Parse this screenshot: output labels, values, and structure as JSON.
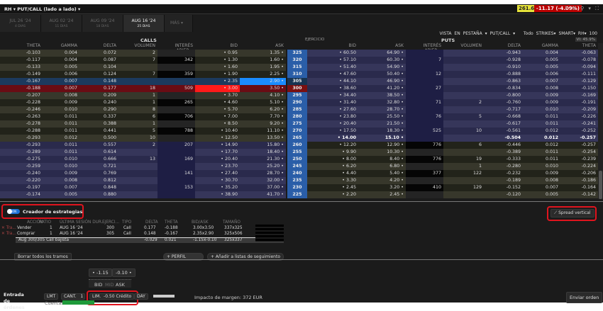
{
  "window": {
    "title": "RH ▾ PUT/CALL (lado a lado) ▾",
    "price": "261.67",
    "change": "-11.17 (-4.09%)",
    "icons": [
      "help-icon",
      "gear-icon",
      "link-icon",
      "menu-icon",
      "expand-icon"
    ],
    "icon_glyphs": "? ⚙ ⚲ ▾ ⛶"
  },
  "tabs": [
    {
      "label": "JUL 26 '24",
      "days": "4 DIAS"
    },
    {
      "label": "AUG 02 '24",
      "days": "11 DIAS"
    },
    {
      "label": "AUG 09 '24",
      "days": "18 DIAS"
    },
    {
      "label": "AUG 16 '24",
      "days": "25 DIAS",
      "active": true
    }
  ],
  "tab_more": "MÁS ▾",
  "view": {
    "tab_view": "VISTA EN PESTAÑA ▾",
    "putcall": "PUT/CALL ▾",
    "strikes": "Todo STRIKES▾",
    "exchange": "SMART▾",
    "symbol": "RH▾",
    "qty": "100"
  },
  "sections": {
    "calls": "CALLS",
    "puts": "PUTS",
    "strike": "EJERCICIO",
    "iv": "VI: 45.9%"
  },
  "columns": {
    "calls": [
      "THETA",
      "GAMMA",
      "DELTA",
      "VOLUMEN",
      "INTERÉS ABIER...",
      "BID",
      "ASK"
    ],
    "puts": [
      "BID",
      "ASK",
      "INTERÉS ABIER...",
      "VOLUMEN",
      "DELTA",
      "GAMMA",
      "THETA"
    ]
  },
  "colors": {
    "strike": "#2a5ea8",
    "bid_highlight": "#ff1a1a",
    "ask_highlight": "#1a8cff",
    "selected_sell_row": "#6a0c14",
    "selected_buy_row": "#1c3a5e",
    "accent_red": "#e0141e"
  },
  "rows": [
    [
      "-0.103",
      "0.004",
      "0.072",
      "2",
      "",
      "• 0.95",
      "1.35 •",
      "325",
      "• 60.50",
      "64.90 •",
      "",
      "",
      "-0.943",
      "0.004",
      "-0.063"
    ],
    [
      "-0.117",
      "0.004",
      "0.087",
      "7",
      "342",
      "• 1.30",
      "1.60 •",
      "320",
      "• 57.10",
      "60.30 •",
      "7",
      "",
      "-0.928",
      "0.005",
      "-0.078"
    ],
    [
      "-0.133",
      "0.005",
      "0.104",
      "",
      "",
      "• 1.60",
      "1.95 •",
      "315",
      "• 51.40",
      "54.90 •",
      "",
      "",
      "-0.910",
      "0.005",
      "-0.094"
    ],
    [
      "-0.149",
      "0.006",
      "0.124",
      "7",
      "359",
      "• 1.90",
      "2.25 •",
      "310",
      "• 47.60",
      "50.40 •",
      "12",
      "",
      "-0.888",
      "0.006",
      "-0.111"
    ],
    [
      "-0.167",
      "0.007",
      "0.148",
      "",
      "",
      "• 2.35",
      "2.90 •",
      "305",
      "• 44.10",
      "46.90 •",
      "",
      "",
      "-0.863",
      "0.007",
      "-0.129"
    ],
    [
      "-0.188",
      "0.007",
      "0.177",
      "18",
      "509",
      "• 3.00",
      "3.50 •",
      "300",
      "• 38.60",
      "41.20 •",
      "27",
      "",
      "-0.834",
      "0.008",
      "-0.150"
    ],
    [
      "-0.207",
      "0.008",
      "0.209",
      "1",
      "",
      "• 3.70",
      "4.10 •",
      "295",
      "• 34.40",
      "38.50 •",
      "",
      "",
      "-0.800",
      "0.009",
      "-0.169"
    ],
    [
      "-0.228",
      "0.009",
      "0.240",
      "1",
      "265",
      "• 4.60",
      "5.10 •",
      "290",
      "• 31.40",
      "32.80 •",
      "71",
      "2",
      "-0.760",
      "0.009",
      "-0.191"
    ],
    [
      "-0.246",
      "0.010",
      "0.290",
      "8",
      "",
      "• 5.70",
      "6.20 •",
      "285",
      "• 27.60",
      "28.70 •",
      "",
      "",
      "-0.717",
      "0.010",
      "-0.209"
    ],
    [
      "-0.263",
      "0.011",
      "0.337",
      "6",
      "706",
      "• 7.00",
      "7.70 •",
      "280",
      "• 23.80",
      "25.50 •",
      "76",
      "5",
      "-0.668",
      "0.011",
      "-0.226"
    ],
    [
      "-0.278",
      "0.011",
      "0.388",
      "1",
      "",
      "• 8.50",
      "9.20 •",
      "275",
      "• 20.40",
      "21.50 •",
      "",
      "",
      "-0.617",
      "0.011",
      "-0.241"
    ],
    [
      "-0.288",
      "0.011",
      "0.441",
      "5",
      "788",
      "• 10.40",
      "11.10 •",
      "270",
      "• 17.50",
      "18.30 •",
      "525",
      "10",
      "-0.561",
      "0.012",
      "-0.252"
    ],
    [
      "-0.293",
      "0.012",
      "0.500",
      "10",
      "",
      "• 12.50",
      "13.50 •",
      "265",
      "• 14.00",
      "15.10 •",
      "",
      "",
      "-0.504",
      "0.012",
      "-0.257"
    ],
    [
      "-0.293",
      "0.011",
      "0.557",
      "2",
      "207",
      "• 14.90",
      "15.80 •",
      "260",
      "• 12.20",
      "12.90 •",
      "776",
      "6",
      "-0.446",
      "0.012",
      "-0.257"
    ],
    [
      "-0.289",
      "0.011",
      "0.614",
      "",
      "",
      "• 17.70",
      "18.40 •",
      "255",
      "• 9.90",
      "10.30 •",
      "",
      "",
      "-0.389",
      "0.011",
      "-0.254"
    ],
    [
      "-0.275",
      "0.010",
      "0.666",
      "13",
      "169",
      "• 20.40",
      "21.30 •",
      "250",
      "• 8.00",
      "8.40 •",
      "776",
      "19",
      "-0.333",
      "0.011",
      "-0.239"
    ],
    [
      "-0.259",
      "0.010",
      "0.721",
      "",
      "",
      "• 23.70",
      "25.20 •",
      "245",
      "• 6.20",
      "6.80 •",
      "",
      "1",
      "-0.280",
      "0.010",
      "-0.224"
    ],
    [
      "-0.240",
      "0.009",
      "0.769",
      "",
      "141",
      "• 27.40",
      "28.70 •",
      "240",
      "• 4.40",
      "5.40 •",
      "377",
      "122",
      "-0.232",
      "0.009",
      "-0.206"
    ],
    [
      "-0.220",
      "0.008",
      "0.812",
      "",
      "",
      "• 30.70",
      "32.00 •",
      "235",
      "• 3.30",
      "4.20 •",
      "",
      "",
      "-0.189",
      "0.008",
      "-0.186"
    ],
    [
      "-0.197",
      "0.007",
      "0.848",
      "",
      "153",
      "• 35.20",
      "37.00 •",
      "230",
      "• 2.45",
      "3.20 •",
      "410",
      "129",
      "-0.152",
      "0.007",
      "-0.164"
    ],
    [
      "-0.174",
      "0.005",
      "0.880",
      "",
      "",
      "• 38.90",
      "41.70 •",
      "225",
      "• 2.20",
      "2.45 •",
      "",
      "",
      "-0.120",
      "0.005",
      "-0.142"
    ]
  ],
  "strategy": {
    "toggle": "ON",
    "title": "Creador de estrategias",
    "preset": "Spread vertical",
    "columns": [
      "ACCIÓN",
      "RATIO",
      "ÚLTIMA SESIÓN DUR...",
      "EJERCI...",
      "TIPO",
      "DELTA",
      "THETA",
      "BID/ASK",
      "TAMAÑO"
    ],
    "legs": [
      {
        "x": "✕ Tra...",
        "action": "Vender",
        "ratio": "1",
        "expiry": "AUG 16 '24",
        "strike": "300",
        "type": "Call",
        "delta": "0.177",
        "theta": "-0.188",
        "bidask": "3.00x3.50",
        "size": "337x325"
      },
      {
        "x": "✕ Tra...",
        "action": "Comprar",
        "ratio": "1",
        "expiry": "AUG 16 '24",
        "strike": "305",
        "type": "Call",
        "delta": "0.148",
        "theta": "-0.167",
        "bidask": "2.35x2.90",
        "size": "325x506"
      }
    ],
    "summary": {
      "name": "Aug 300/305 Call bajista",
      "delta": "-0.029",
      "theta": "0.021",
      "bidask": "-1.15x-0.10",
      "size": "325x337"
    },
    "clear": "Borrar todos los tramos",
    "profile": "+ PERFIL",
    "watchlist": "+ Añadir a listas de seguimiento"
  },
  "order": {
    "bid_btn": "• -1.15",
    "ask_btn": "-0.10 •",
    "bid": "BID",
    "mid": "MID",
    "ask": "ASK",
    "label": "Entrada de órdenes",
    "type": "LMT",
    "qty_label": "CANT.",
    "qty": "1",
    "lim_label": "LIM.",
    "lim": "-0.50 Crédito",
    "tif": "DAY",
    "account_label": "Cuentas:",
    "margin": "Impacto de margen: 372 EUR",
    "submit": "Enviar orden"
  }
}
